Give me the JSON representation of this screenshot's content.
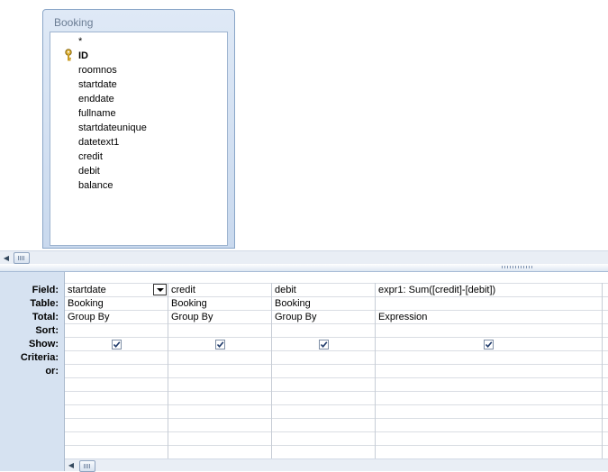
{
  "table": {
    "title": "Booking",
    "fields": [
      "*",
      "ID",
      "roomnos",
      "startdate",
      "enddate",
      "fullname",
      "startdateunique",
      "datetext1",
      "credit",
      "debit",
      "balance"
    ],
    "key_field": "ID"
  },
  "row_labels": {
    "field": "Field:",
    "table": "Table:",
    "total": "Total:",
    "sort": "Sort:",
    "show": "Show:",
    "criteria": "Criteria:",
    "or": "or:"
  },
  "columns": [
    {
      "field": "startdate",
      "table": "Booking",
      "total": "Group By",
      "show": true
    },
    {
      "field": "credit",
      "table": "Booking",
      "total": "Group By",
      "show": true
    },
    {
      "field": "debit",
      "table": "Booking",
      "total": "Group By",
      "show": true
    },
    {
      "field": "expr1: Sum([credit]-[debit])",
      "table": "",
      "total": "Expression",
      "show": true
    }
  ],
  "icons": {
    "key": "key-icon",
    "dropdown": "chevron-down-icon",
    "scroll_left": "scroll-left-icon",
    "check": "check-icon"
  }
}
